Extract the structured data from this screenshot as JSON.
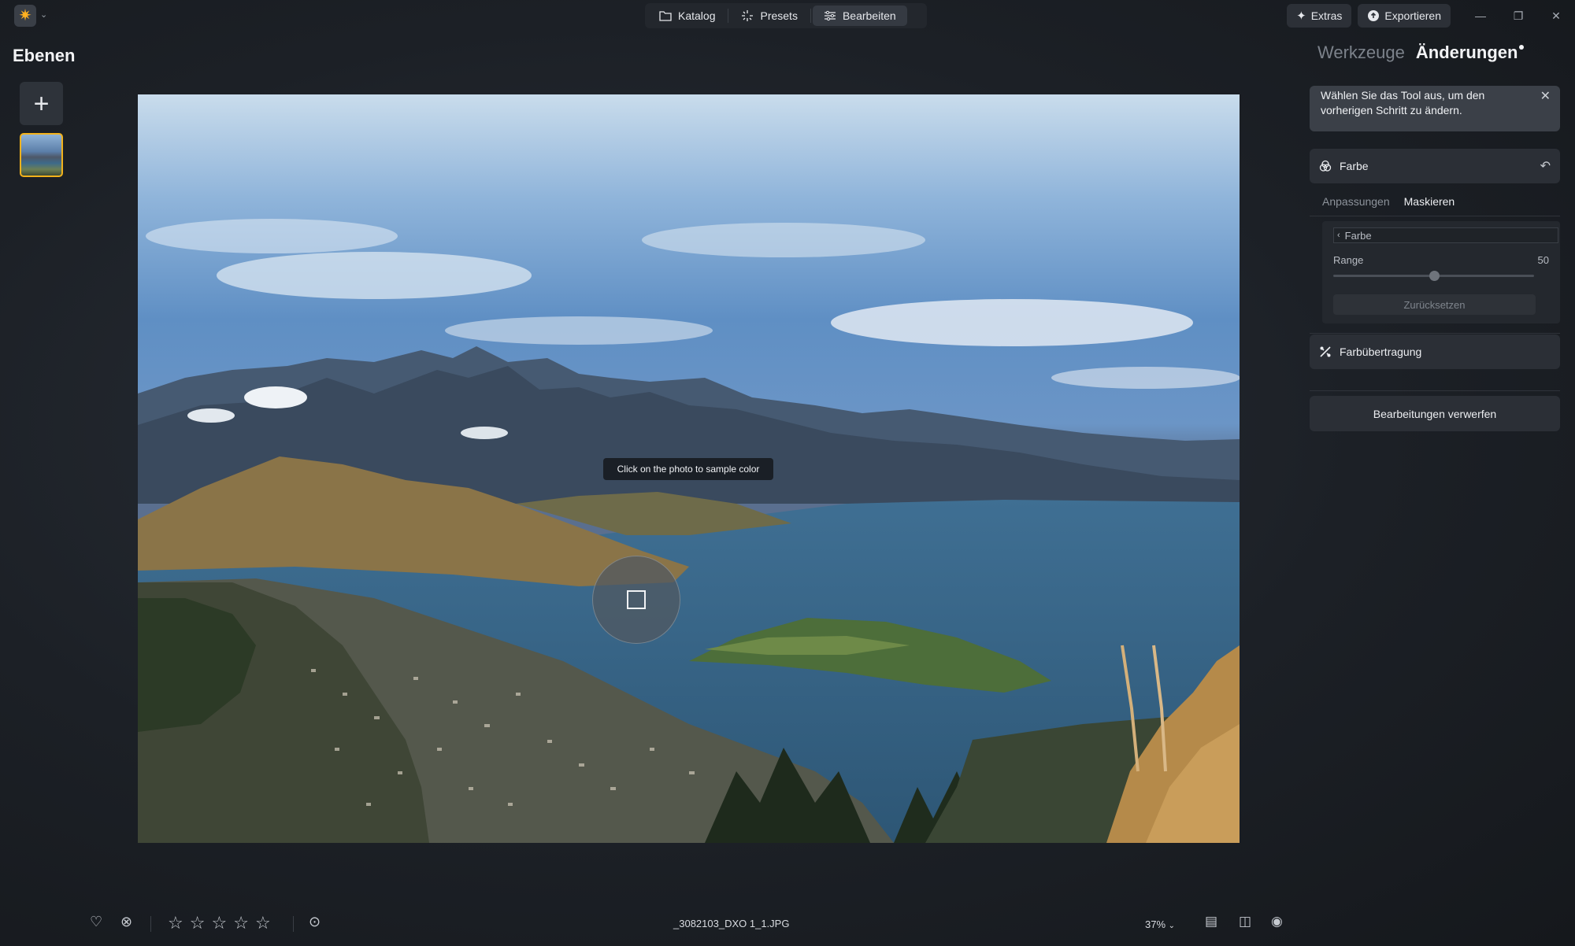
{
  "app": {
    "logo_icon": "sun-logo-icon"
  },
  "modes": [
    {
      "label": "Katalog",
      "icon": "folder-icon"
    },
    {
      "label": "Presets",
      "icon": "sparkle-icon"
    },
    {
      "label": "Bearbeiten",
      "icon": "sliders-icon",
      "active": true
    }
  ],
  "top_actions": {
    "extras": "Extras",
    "export": "Exportieren"
  },
  "left_panel": {
    "title": "Ebenen"
  },
  "canvas": {
    "hint": "Click on the photo to sample color"
  },
  "right_panel": {
    "tabs": {
      "tools": "Werkzeuge",
      "changes": "Änderungen"
    },
    "info": "Wählen Sie das Tool aus, um den vorherigen Schritt zu ändern.",
    "color_section": {
      "title": "Farbe",
      "subtabs": {
        "adjust": "Anpassungen",
        "mask": "Maskieren"
      },
      "color_field": "Farbe",
      "range_label": "Range",
      "range_value": "50",
      "range_fraction": 0.5,
      "reset": "Zurücksetzen"
    },
    "transfer_section": {
      "title": "Farbübertragung"
    },
    "discard": "Bearbeitungen verwerfen"
  },
  "bottom_bar": {
    "filename": "_3082103_DXO 1_1.JPG",
    "zoom": "37%",
    "rating_stars": 0,
    "star_glyph": "☆"
  }
}
